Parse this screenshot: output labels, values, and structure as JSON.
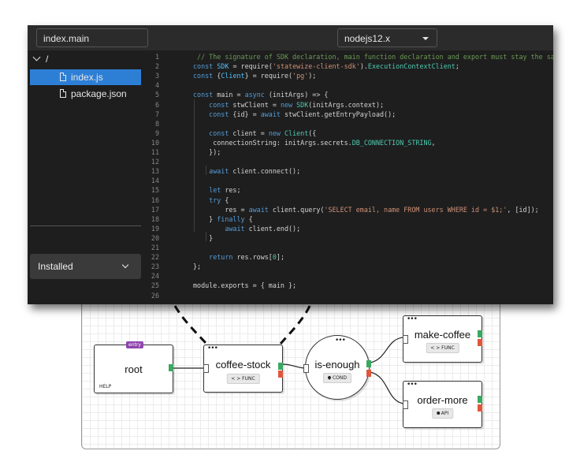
{
  "editor": {
    "function_name": "index.main",
    "runtime": "nodejs12.x",
    "file_tree": {
      "root": "/",
      "files": [
        {
          "name": "index.js",
          "active": true
        },
        {
          "name": "package.json",
          "active": false
        }
      ]
    },
    "installed_label": "Installed",
    "code_lines": [
      {
        "n": "1",
        "tokens": [
          {
            "t": " // The signature of SDK declaration, main function declaration and export must stay the same",
            "c": "com"
          }
        ]
      },
      {
        "n": "2",
        "tokens": [
          {
            "t": "const ",
            "c": "kw"
          },
          {
            "t": "SDK",
            "c": "con"
          },
          {
            "t": " = require(",
            "c": "pl"
          },
          {
            "t": "'statewize-client-sdk'",
            "c": "str"
          },
          {
            "t": ").",
            "c": "pl"
          },
          {
            "t": "ExecutionContextClient",
            "c": "cls"
          },
          {
            "t": ";",
            "c": "pl"
          }
        ]
      },
      {
        "n": "3",
        "tokens": [
          {
            "t": "const ",
            "c": "kw"
          },
          {
            "t": "{",
            "c": "pl"
          },
          {
            "t": "Client",
            "c": "con"
          },
          {
            "t": "} = require(",
            "c": "pl"
          },
          {
            "t": "'pg'",
            "c": "str"
          },
          {
            "t": ");",
            "c": "pl"
          }
        ]
      },
      {
        "n": "4",
        "tokens": []
      },
      {
        "n": "5",
        "tokens": [
          {
            "t": "const ",
            "c": "kw"
          },
          {
            "t": "main = ",
            "c": "pl"
          },
          {
            "t": "async ",
            "c": "kw"
          },
          {
            "t": "(initArgs) => {",
            "c": "pl"
          }
        ]
      },
      {
        "n": "6",
        "tokens": [
          {
            "t": "    const ",
            "c": "kw"
          },
          {
            "t": "stwClient = ",
            "c": "pl"
          },
          {
            "t": "new ",
            "c": "kw"
          },
          {
            "t": "SDK",
            "c": "cls"
          },
          {
            "t": "(initArgs.context);",
            "c": "pl"
          }
        ]
      },
      {
        "n": "7",
        "tokens": [
          {
            "t": "    const ",
            "c": "kw"
          },
          {
            "t": "{id} = ",
            "c": "pl"
          },
          {
            "t": "await ",
            "c": "kw"
          },
          {
            "t": "stwClient.getEntryPayload();",
            "c": "pl"
          }
        ]
      },
      {
        "n": "8",
        "tokens": []
      },
      {
        "n": "9",
        "tokens": [
          {
            "t": "    const ",
            "c": "kw"
          },
          {
            "t": "client = ",
            "c": "pl"
          },
          {
            "t": "new ",
            "c": "kw"
          },
          {
            "t": "Client",
            "c": "cls"
          },
          {
            "t": "({",
            "c": "pl"
          }
        ]
      },
      {
        "n": "10",
        "tokens": [
          {
            "t": "     connectionString: initArgs.secrets.",
            "c": "pl"
          },
          {
            "t": "DB_CONNECTION_STRING",
            "c": "cls"
          },
          {
            "t": ",",
            "c": "pl"
          }
        ]
      },
      {
        "n": "11",
        "tokens": [
          {
            "t": "    });",
            "c": "pl"
          }
        ]
      },
      {
        "n": "12",
        "tokens": []
      },
      {
        "n": "13",
        "tokens": [
          {
            "t": "    await ",
            "c": "kw"
          },
          {
            "t": "client.connect();",
            "c": "pl"
          }
        ]
      },
      {
        "n": "14",
        "tokens": []
      },
      {
        "n": "15",
        "tokens": [
          {
            "t": "    let ",
            "c": "kw"
          },
          {
            "t": "res;",
            "c": "pl"
          }
        ]
      },
      {
        "n": "16",
        "tokens": [
          {
            "t": "    try ",
            "c": "kw"
          },
          {
            "t": "{",
            "c": "pl"
          }
        ]
      },
      {
        "n": "17",
        "tokens": [
          {
            "t": "        res = ",
            "c": "pl"
          },
          {
            "t": "await ",
            "c": "kw"
          },
          {
            "t": "client.query(",
            "c": "pl"
          },
          {
            "t": "'SELECT email, name FROM users WHERE id = $1;'",
            "c": "str"
          },
          {
            "t": ", [id]);",
            "c": "pl"
          }
        ]
      },
      {
        "n": "18",
        "tokens": [
          {
            "t": "    } ",
            "c": "pl"
          },
          {
            "t": "finally ",
            "c": "kw"
          },
          {
            "t": "{",
            "c": "pl"
          }
        ]
      },
      {
        "n": "19",
        "tokens": [
          {
            "t": "        await ",
            "c": "kw"
          },
          {
            "t": "client.end();",
            "c": "pl"
          }
        ]
      },
      {
        "n": "20",
        "tokens": [
          {
            "t": "    }",
            "c": "pl"
          }
        ]
      },
      {
        "n": "21",
        "tokens": []
      },
      {
        "n": "22",
        "tokens": [
          {
            "t": "    return ",
            "c": "kw"
          },
          {
            "t": "res.rows[",
            "c": "pl"
          },
          {
            "t": "0",
            "c": "cls"
          },
          {
            "t": "];",
            "c": "pl"
          }
        ]
      },
      {
        "n": "23",
        "tokens": [
          {
            "t": "};",
            "c": "pl"
          }
        ]
      },
      {
        "n": "24",
        "tokens": []
      },
      {
        "n": "25",
        "tokens": [
          {
            "t": "module.exports = { main };",
            "c": "pl"
          }
        ]
      },
      {
        "n": "26",
        "tokens": []
      }
    ]
  },
  "flow": {
    "nodes": {
      "root": {
        "title": "root",
        "tag": "entry",
        "footer": "HELP"
      },
      "coffee_stock": {
        "title": "coffee-stock",
        "badge": "< > FUNC"
      },
      "is_enough": {
        "title": "is-enough",
        "badge": "COND"
      },
      "make_coffee": {
        "title": "make-coffee",
        "badge": "< > FUNC"
      },
      "order_more": {
        "title": "order-more",
        "badge": "API"
      }
    },
    "menu_glyph": "•••"
  },
  "colors": {
    "accent": "#2d7fd6",
    "port_success": "#3aa860",
    "port_error": "#e0563b",
    "entry_tag": "#8e44ad"
  }
}
